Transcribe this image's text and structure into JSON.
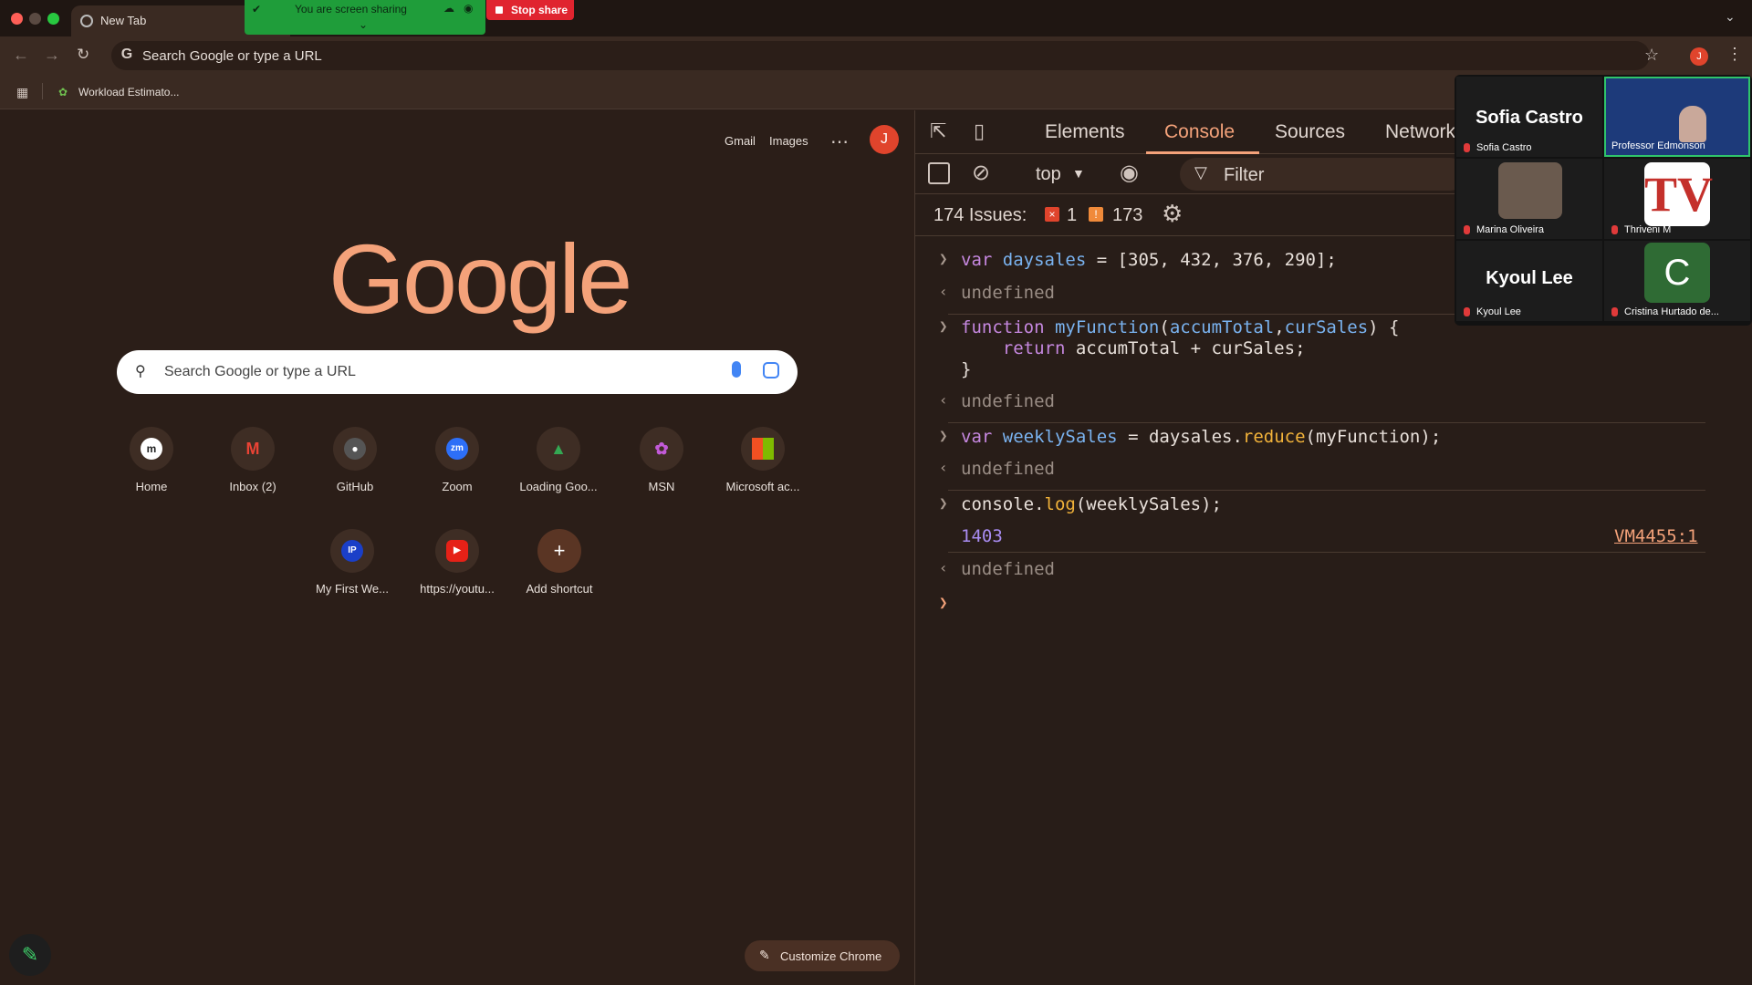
{
  "window": {
    "tab_title": "New Tab",
    "share_banner": "You are screen sharing",
    "stop_share": "Stop share",
    "omnibox_text": "Search Google or type a URL",
    "profile_initial": "J",
    "bookmark_label": "Workload Estimato..."
  },
  "ntp": {
    "gmail": "Gmail",
    "images": "Images",
    "avatar": "J",
    "logo": "Google",
    "search_placeholder": "Search Google or type a URL",
    "shortcuts": [
      {
        "label": "Home",
        "icon": "m-icon"
      },
      {
        "label": "Inbox (2)",
        "icon": "gmail-icon"
      },
      {
        "label": "GitHub",
        "icon": "github-icon"
      },
      {
        "label": "Zoom",
        "icon": "zoom-icon"
      },
      {
        "label": "Loading Goo...",
        "icon": "google-drive-icon"
      },
      {
        "label": "MSN",
        "icon": "msn-icon"
      },
      {
        "label": "Microsoft ac...",
        "icon": "microsoft-icon"
      },
      {
        "label": "My First We...",
        "icon": "ip-icon"
      },
      {
        "label": "https://youtu...",
        "icon": "youtube-icon"
      },
      {
        "label": "Add shortcut",
        "icon": "plus-icon"
      }
    ],
    "customize": "Customize Chrome"
  },
  "devtools": {
    "tabs": [
      "Elements",
      "Console",
      "Sources",
      "Network"
    ],
    "active_tab": "Console",
    "context": "top",
    "filter_placeholder": "Filter",
    "issues_label": "174 Issues:",
    "errors": "1",
    "warnings": "173",
    "console": {
      "l1_kw": "var",
      "l1_name": "daysales",
      "l1_rest": " = [305, 432, 376, 290];",
      "undef": "undefined",
      "l2_kw": "function",
      "l2_fn": "myFunction",
      "l2_p1": "accumTotal",
      "l2_p2": "curSales",
      "l2_open": ") {",
      "l2_ret_kw": "return",
      "l2_ret_body": " accumTotal + curSales;",
      "l2_close": "}",
      "l3_kw": "var",
      "l3_name": "weeklySales",
      "l3_mid": " = daysales.",
      "l3_method": "reduce",
      "l3_end": "(myFunction);",
      "l4_obj": "console.",
      "l4_method": "log",
      "l4_end": "(weeklySales);",
      "result": "1403",
      "source_link": "VM4455:1"
    }
  },
  "zoom": {
    "participants": [
      {
        "name": "Sofia Castro",
        "big": "Sofia Castro"
      },
      {
        "name": "Professor Edmonson",
        "big": ""
      },
      {
        "name": "Marina Oliveira",
        "big": ""
      },
      {
        "name": "Thriveni M",
        "big": ""
      },
      {
        "name": "Kyoul Lee",
        "big": "Kyoul Lee"
      },
      {
        "name": "Cristina Hurtado de...",
        "big": "C"
      }
    ]
  }
}
